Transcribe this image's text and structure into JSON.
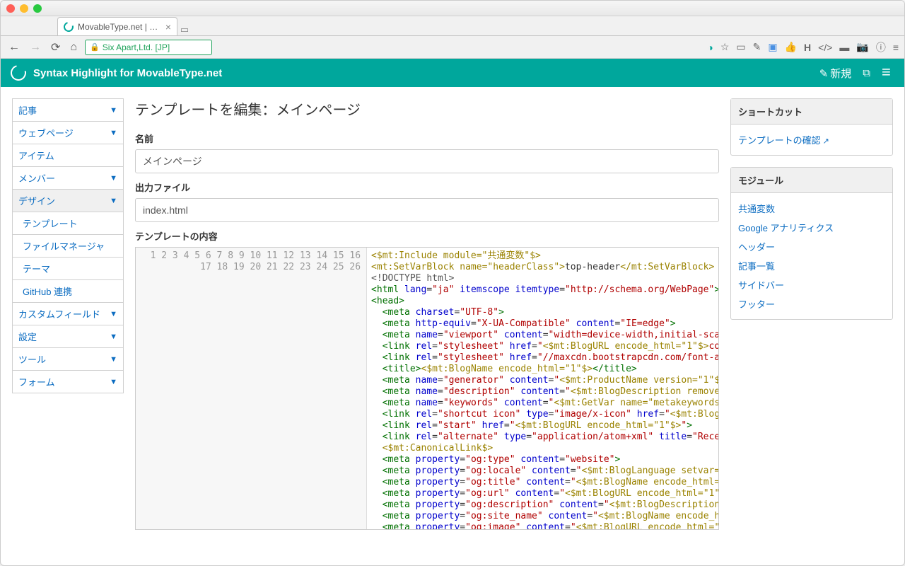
{
  "browser": {
    "tab_title": "MovableType.net | Syntax H",
    "url_label": "Six Apart,Ltd. [JP]"
  },
  "header": {
    "title": "Syntax Highlight for MovableType.net",
    "new_label": "新規"
  },
  "sidebar": {
    "items": [
      {
        "label": "記事"
      },
      {
        "label": "ウェブページ"
      },
      {
        "label": "アイテム"
      },
      {
        "label": "メンバー"
      },
      {
        "label": "デザイン"
      },
      {
        "label": "カスタムフィールド"
      },
      {
        "label": "設定"
      },
      {
        "label": "ツール"
      },
      {
        "label": "フォーム"
      }
    ],
    "design_sub": [
      {
        "label": "テンプレート"
      },
      {
        "label": "ファイルマネージャ"
      },
      {
        "label": "テーマ"
      },
      {
        "label": "GitHub 連携"
      }
    ]
  },
  "main": {
    "page_title": "テンプレートを編集：メインページ",
    "label_name": "名前",
    "value_name": "メインページ",
    "label_output": "出力ファイル",
    "value_output": "index.html",
    "label_content": "テンプレートの内容"
  },
  "shortcuts": {
    "title": "ショートカット",
    "link_confirm": "テンプレートの確認"
  },
  "modules": {
    "title": "モジュール",
    "items": [
      "共通変数",
      "Google アナリティクス",
      "ヘッダー",
      "記事一覧",
      "サイドバー",
      "フッター"
    ]
  },
  "code_lines": 26
}
